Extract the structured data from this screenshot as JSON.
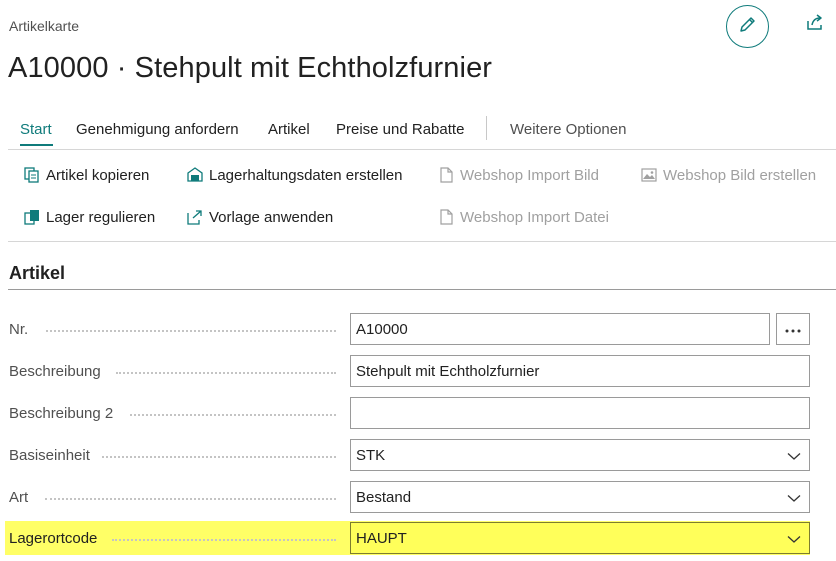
{
  "page": {
    "caption": "Artikelkarte",
    "title": "A10000 · Stehpult mit Echtholzfurnier"
  },
  "header_icons": [
    "pencil-icon",
    "share-icon"
  ],
  "tabs": [
    {
      "label": "Start",
      "active": true
    },
    {
      "label": "Genehmigung anfordern",
      "active": false
    },
    {
      "label": "Artikel",
      "active": false
    },
    {
      "label": "Preise und Rabatte",
      "active": false
    },
    {
      "label": "Weitere Optionen",
      "active": false
    }
  ],
  "actions": [
    {
      "label": "Artikel kopieren",
      "icon": "copy-icon",
      "enabled": true
    },
    {
      "label": "Lagerhaltungsdaten erstellen",
      "icon": "warehouse-icon",
      "enabled": true
    },
    {
      "label": "Webshop Import Bild",
      "icon": "document-icon",
      "enabled": false
    },
    {
      "label": "Webshop Bild erstellen",
      "icon": "image-icon",
      "enabled": false
    },
    {
      "label": "Lager regulieren",
      "icon": "adjust-inventory-icon",
      "enabled": true
    },
    {
      "label": "Vorlage anwenden",
      "icon": "apply-template-icon",
      "enabled": true
    },
    {
      "label": "Webshop Import Datei",
      "icon": "document-icon",
      "enabled": false
    }
  ],
  "section": {
    "title": "Artikel"
  },
  "fields": [
    {
      "label": "Nr.",
      "value": "A10000",
      "type": "text-with-lookup"
    },
    {
      "label": "Beschreibung",
      "value": "Stehpult mit Echtholzfurnier",
      "type": "text"
    },
    {
      "label": "Beschreibung 2",
      "value": "",
      "type": "text"
    },
    {
      "label": "Basiseinheit",
      "value": "STK",
      "type": "dropdown"
    },
    {
      "label": "Art",
      "value": "Bestand",
      "type": "dropdown"
    },
    {
      "label": "Lagerortcode",
      "value": "HAUPT",
      "type": "dropdown",
      "highlighted": true
    }
  ],
  "colors": {
    "accent": "#0f7b7b",
    "highlight": "#ffff66",
    "disabled_text": "#a0a0a0"
  }
}
